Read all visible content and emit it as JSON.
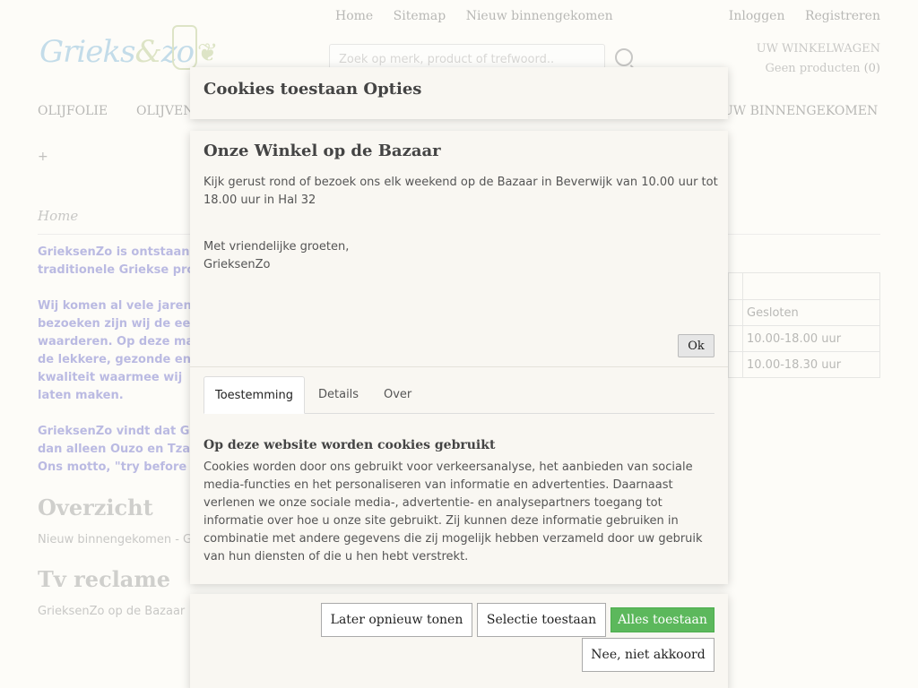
{
  "header": {
    "top_links": [
      "Home",
      "Sitemap",
      "Nieuw binnengekomen"
    ],
    "account_links": [
      "Inloggen",
      "Registreren"
    ],
    "logo_text_1": "Grieks",
    "logo_text_amp": "&",
    "logo_text_2": "zo",
    "search_placeholder": "Zoek op merk, product of trefwoord..",
    "cart_title": "UW WINKELWAGEN",
    "cart_status": "Geen producten",
    "cart_count": "(0)"
  },
  "nav": {
    "items": [
      "OLIJFOLIE",
      "OLIJVEN",
      "UW BINNENGEKOMEN"
    ],
    "more": "+"
  },
  "page": {
    "breadcrumb": "Home",
    "intro_lines_1": [
      "GrieksenZo is ontstaan",
      "traditionele Griekse pro"
    ],
    "intro_lines_2": [
      "Wij komen al vele jaren",
      "bezoeken zijn wij de ee",
      "waarderen. Op deze ma",
      "de lekkere, gezonde en",
      "kwaliteit waarmee wij",
      "laten maken."
    ],
    "intro_lines_3": [
      "GrieksenZo vindt dat Gr",
      "dan alleen Ouzo en Tza",
      "Ons motto,  \"try before"
    ],
    "overview_title": "Overzicht",
    "overview_text": "Nieuw binnengekomen - G",
    "tv_title": "Tv reclame",
    "tv_text": "GrieksenZo op de Bazaar",
    "hours": [
      "Gesloten",
      "10.00-18.00 uur",
      "10.00-18.30 uur"
    ]
  },
  "modal": {
    "header_title": "Cookies toestaan Opties",
    "message_title": "Onze Winkel op de Bazaar",
    "message_para1": "Kijk gerust rond of bezoek ons elk weekend op de Bazaar in Beverwijk van 10.00 uur tot 18.00 uur in Hal 32",
    "message_para2_line1": "Met vriendelijke groeten,",
    "message_para2_line2": "GrieksenZo",
    "ok_label": "Ok",
    "tabs": [
      "Toestemming",
      "Details",
      "Over"
    ],
    "cookie_title": "Op deze website worden cookies gebruikt",
    "cookie_text": "Cookies worden door ons gebruikt voor verkeersanalyse, het aanbieden van sociale media-functies en het personaliseren van informatie en advertenties. Daarnaast verlenen we onze sociale media-, advertentie- en analysepartners toegang tot informatie over hoe u onze site gebruikt. Zij kunnen deze informatie gebruiken in combinatie met andere gegevens die zij mogelijk hebben verzameld door uw gebruik van hun diensten of die u hen hebt verstrekt.",
    "btn_later": "Later opnieuw tonen",
    "btn_selection": "Selectie toestaan",
    "btn_allow_all": "Alles toestaan",
    "btn_decline": "Nee, niet akkoord",
    "allow_color": "#5cb85c"
  }
}
